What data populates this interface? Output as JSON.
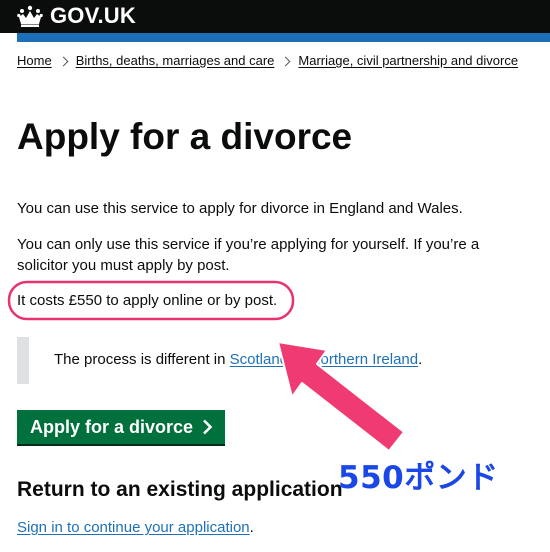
{
  "header": {
    "logo_text": "GOV.UK",
    "brand_black": "#0b0c0c",
    "brand_blue": "#1d70b8"
  },
  "breadcrumbs": [
    {
      "label": "Home"
    },
    {
      "label": "Births, deaths, marriages and care"
    },
    {
      "label": "Marriage, civil partnership and divorce"
    }
  ],
  "page": {
    "title": "Apply for a divorce",
    "intro": "You can use this service to apply for divorce in England and Wales.",
    "solicitor_note": "You can only use this service if you’re applying for yourself. If you’re a solicitor you must apply by post.",
    "cost": "It costs £550 to apply online or by post.",
    "inset": {
      "prefix": "The process is different in ",
      "link1": "Scotland",
      "middle": " or ",
      "link2": "Northern Ireland",
      "suffix": "."
    },
    "start_button": "Apply for a divorce",
    "existing_heading": "Return to an existing application",
    "signin_link": "Sign in to continue your application",
    "signin_suffix": "."
  },
  "annotation": {
    "label": "550ポンド",
    "highlight_color": "#e8336e",
    "label_color": "#1a47e6"
  }
}
